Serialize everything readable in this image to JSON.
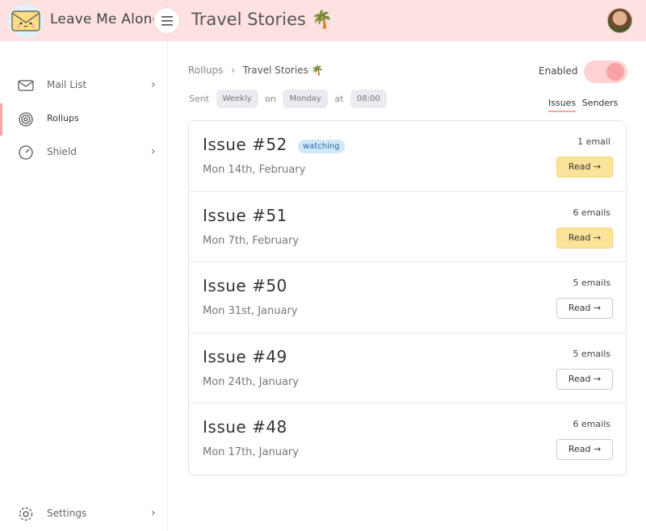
{
  "app": {
    "name": "Leave Me Alone",
    "logo_icon": "envelope-face-icon"
  },
  "header": {
    "title": "Travel Stories 🌴",
    "menu_icon": "hamburger-icon",
    "avatar": "user-avatar"
  },
  "sidebar": {
    "items": [
      {
        "label": "Mail List",
        "icon": "envelope-icon",
        "has_chevron": true,
        "active": false
      },
      {
        "label": "Rollups",
        "icon": "target-icon",
        "has_chevron": false,
        "active": true
      },
      {
        "label": "Shield",
        "icon": "shield-icon",
        "has_chevron": true,
        "active": false
      },
      {
        "label": "Settings",
        "icon": "gear-icon",
        "has_chevron": true,
        "active": false
      }
    ],
    "chevron": "›"
  },
  "main": {
    "breadcrumb": {
      "root": "Rollups",
      "separator": "›",
      "current": "Travel Stories 🌴"
    },
    "enabled": {
      "label": "Enabled",
      "value": true
    },
    "schedule": {
      "sent_label": "Sent",
      "frequency": "Weekly",
      "on_label": "on",
      "day": "Monday",
      "at_label": "at",
      "time": "08:00"
    },
    "tabs": [
      {
        "label": "Issues",
        "active": true
      },
      {
        "label": "Senders",
        "active": false
      }
    ],
    "issues": [
      {
        "title": "Issue #52",
        "badge": "watching",
        "date": "Mon 14th, February",
        "count": "1 email",
        "read_label": "Read →",
        "highlight": true
      },
      {
        "title": "Issue #51",
        "badge": "",
        "date": "Mon 7th, February",
        "count": "6 emails",
        "read_label": "Read →",
        "highlight": true
      },
      {
        "title": "Issue #50",
        "badge": "",
        "date": "Mon 31st, January",
        "count": "5 emails",
        "read_label": "Read →",
        "highlight": false
      },
      {
        "title": "Issue #49",
        "badge": "",
        "date": "Mon 24th, January",
        "count": "5 emails",
        "read_label": "Read →",
        "highlight": false
      },
      {
        "title": "Issue #48",
        "badge": "",
        "date": "Mon 17th, January",
        "count": "6 emails",
        "read_label": "Read →",
        "highlight": false
      }
    ]
  },
  "colors": {
    "header_bg": "#fde2e1",
    "accent": "#f4a8a5",
    "read_primary": "#fbe39a",
    "badge_bg": "#cfe8fa"
  }
}
